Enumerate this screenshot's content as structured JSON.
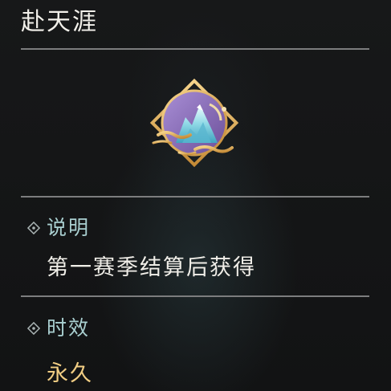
{
  "item": {
    "name": "赴天涯",
    "icon": "mountain-badge-icon"
  },
  "sections": {
    "description": {
      "label": "说明",
      "text": "第一赛季结算后获得"
    },
    "validity": {
      "label": "时效",
      "text": "永久"
    }
  },
  "colors": {
    "label": "#a9cfd0",
    "text": "#f0eee8",
    "duration": "#f1cd83",
    "divider": "#7c7d7e",
    "badge_purple": "#8a6fb3",
    "badge_gold": "#e0b35c"
  }
}
